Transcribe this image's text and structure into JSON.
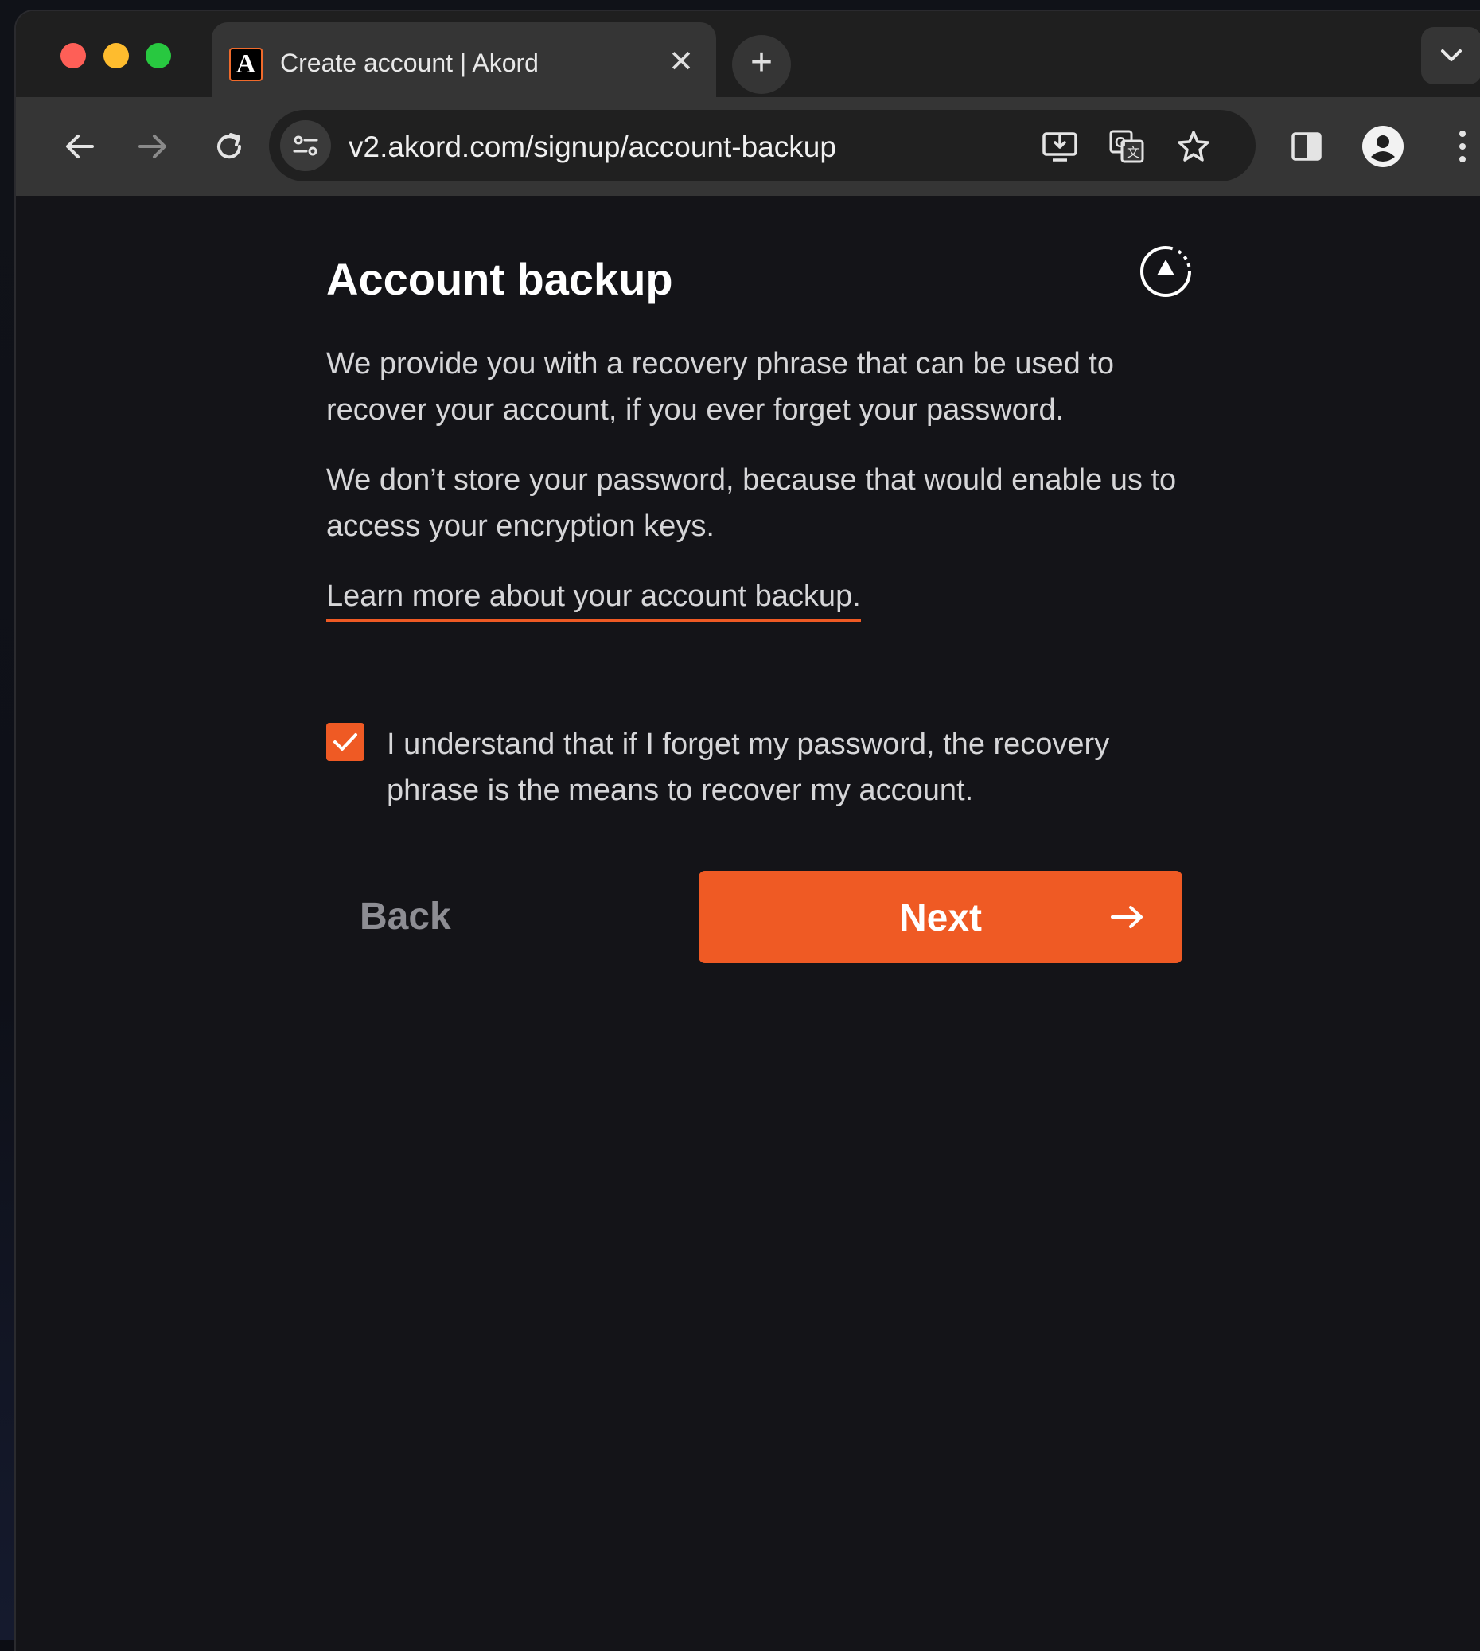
{
  "browser": {
    "tab": {
      "title": "Create account | Akord",
      "favicon_letter": "A",
      "close_glyph": "✕"
    },
    "new_tab_glyph": "+",
    "address_bar": {
      "url": "v2.akord.com/signup/account-backup"
    },
    "toolbar_icons": [
      "back-arrow-icon",
      "forward-arrow-icon",
      "reload-icon",
      "site-settings-icon",
      "install-app-icon",
      "translate-icon",
      "bookmark-star-icon",
      "side-panel-icon",
      "profile-icon",
      "more-menu-icon",
      "tab-search-chevron-icon"
    ]
  },
  "page": {
    "title": "Account backup",
    "paragraph1": "We provide you with a recovery phrase that can be used to recover your account, if you ever forget your password.",
    "paragraph2": "We don’t store your password, because that would enable us to access your encryption keys.",
    "learn_more_link": "Learn more about your account backup.",
    "consent_checkbox": {
      "checked": true,
      "label": "I understand that if I forget my password, the recovery phrase is the means to recover my account."
    },
    "back_button": "Back",
    "next_button": "Next",
    "accent_color": "#ef5a24"
  }
}
